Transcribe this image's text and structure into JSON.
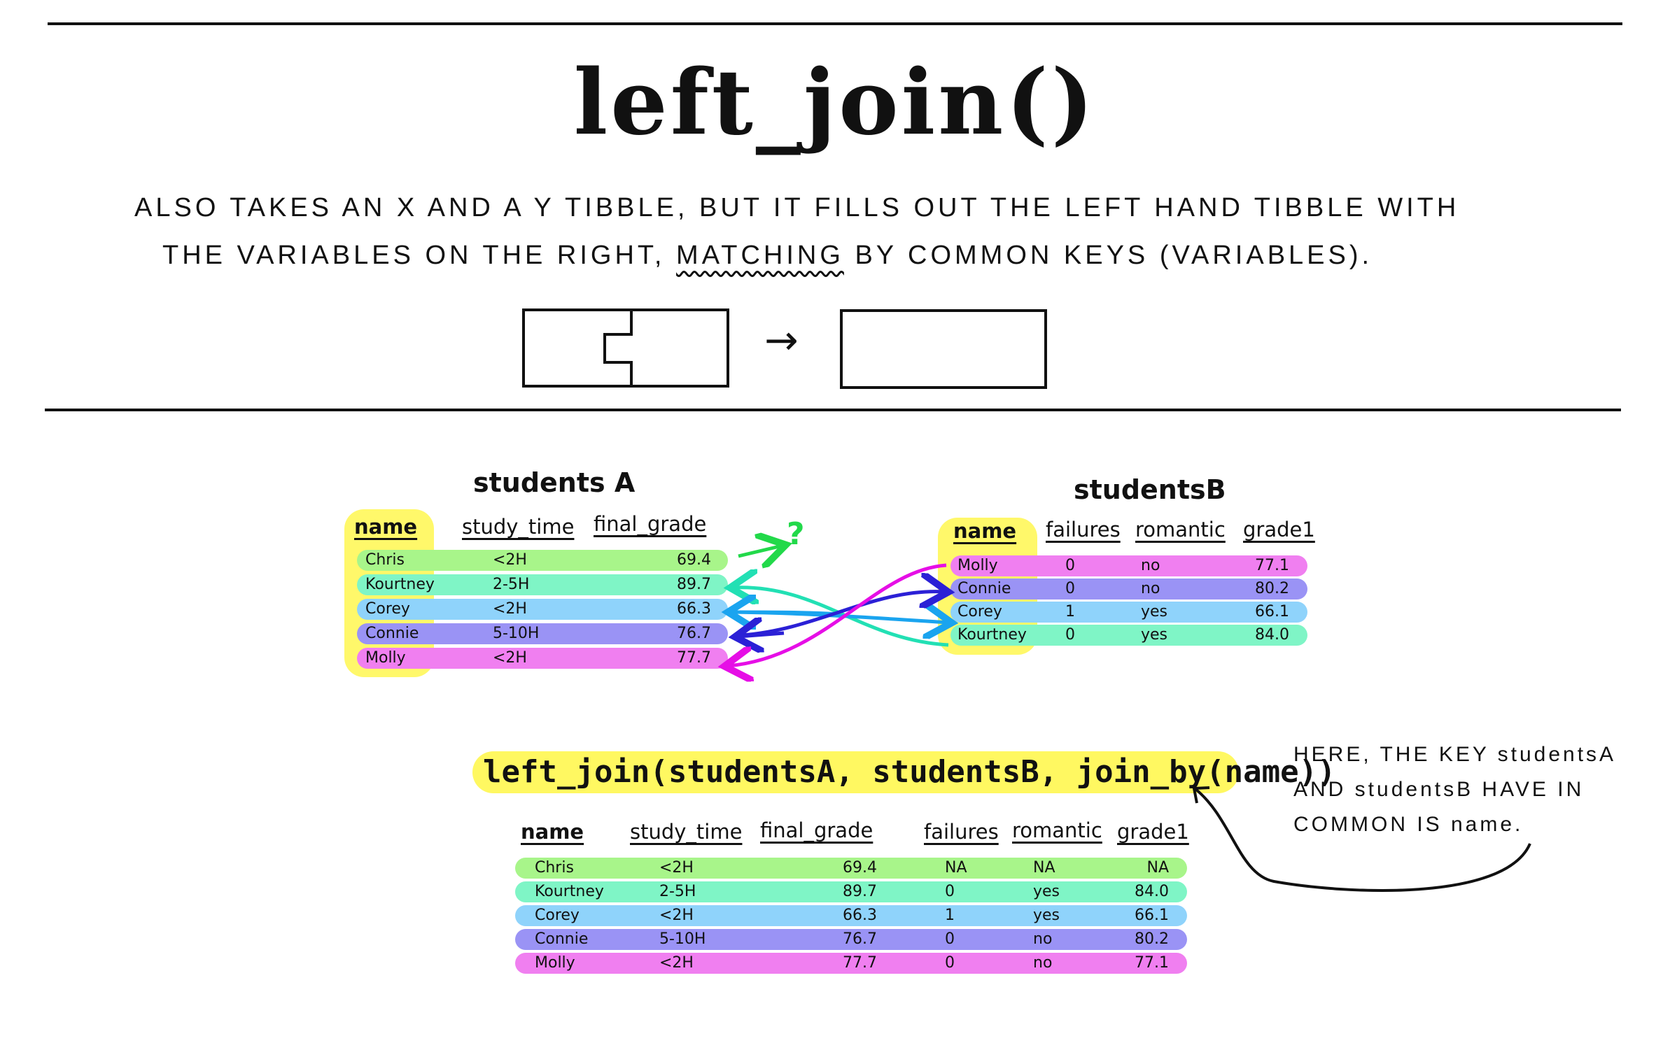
{
  "title": "left_join()",
  "description": {
    "line1": "ALSO TAKES AN X AND A Y TIBBLE, BUT IT FILLS OUT THE LEFT HAND TIBBLE WITH",
    "line2_before": "THE VARIABLES ON THE RIGHT, ",
    "line2_emph": "MATCHING",
    "line2_after": " BY COMMON KEYS (VARIABLES)."
  },
  "arrow_symbol": "→",
  "question_mark": "?",
  "colors": {
    "green": "#a8f58a",
    "teal": "#7ff5c6",
    "blue": "#8fd3fb",
    "purple": "#9a93f5",
    "pink": "#f07ff0",
    "key_highlight": "#fff650"
  },
  "tableA": {
    "name": "students A",
    "headers": [
      "name",
      "study_time",
      "final_grade"
    ],
    "rows": [
      {
        "name": "Chris",
        "study_time": "<2H",
        "final_grade": "69.4"
      },
      {
        "name": "Kourtney",
        "study_time": "2-5H",
        "final_grade": "89.7"
      },
      {
        "name": "Corey",
        "study_time": "<2H",
        "final_grade": "66.3"
      },
      {
        "name": "Connie",
        "study_time": "5-10H",
        "final_grade": "76.7"
      },
      {
        "name": "Molly",
        "study_time": "<2H",
        "final_grade": "77.7"
      }
    ]
  },
  "tableB": {
    "name": "studentsB",
    "headers": [
      "name",
      "failures",
      "romantic",
      "grade1"
    ],
    "rows": [
      {
        "name": "Molly",
        "failures": "0",
        "romantic": "no",
        "grade1": "77.1"
      },
      {
        "name": "Connie",
        "failures": "0",
        "romantic": "no",
        "grade1": "80.2"
      },
      {
        "name": "Corey",
        "failures": "1",
        "romantic": "yes",
        "grade1": "66.1"
      },
      {
        "name": "Kourtney",
        "failures": "0",
        "romantic": "yes",
        "grade1": "84.0"
      }
    ]
  },
  "code": "left_join(studentsA, studentsB, join_by(name))",
  "result": {
    "headers": [
      "name",
      "study_time",
      "final_grade",
      "failures",
      "romantic",
      "grade1"
    ],
    "rows": [
      {
        "name": "Chris",
        "study_time": "<2H",
        "final_grade": "69.4",
        "failures": "NA",
        "romantic": "NA",
        "grade1": "NA"
      },
      {
        "name": "Kourtney",
        "study_time": "2-5H",
        "final_grade": "89.7",
        "failures": "0",
        "romantic": "yes",
        "grade1": "84.0"
      },
      {
        "name": "Corey",
        "study_time": "<2H",
        "final_grade": "66.3",
        "failures": "1",
        "romantic": "yes",
        "grade1": "66.1"
      },
      {
        "name": "Connie",
        "study_time": "5-10H",
        "final_grade": "76.7",
        "failures": "0",
        "romantic": "no",
        "grade1": "80.2"
      },
      {
        "name": "Molly",
        "study_time": "<2H",
        "final_grade": "77.7",
        "failures": "0",
        "romantic": "no",
        "grade1": "77.1"
      }
    ]
  },
  "note": {
    "line1": "HERE, THE KEY studentsA",
    "line2": "AND studentsB HAVE IN",
    "line3": "COMMON IS name."
  }
}
